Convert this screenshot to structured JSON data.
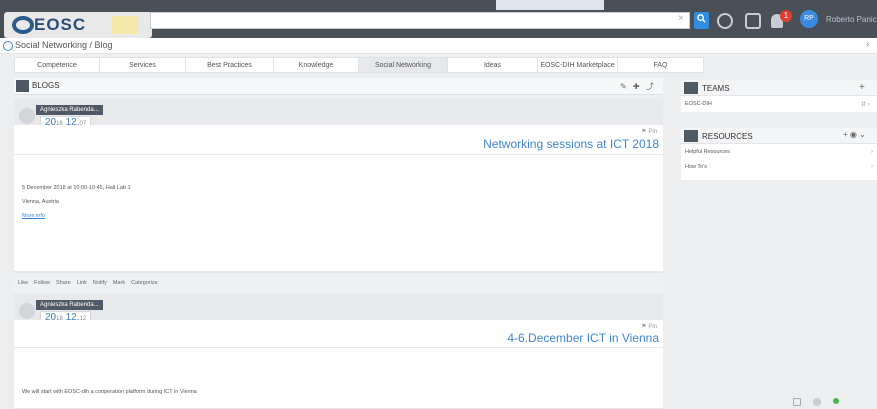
{
  "header": {
    "logo_text": "EOSC",
    "search_placeholder": "",
    "search_clear": "×",
    "search_button_icon": "search-icon",
    "notification_count": "1",
    "avatar_initials": "RP",
    "user_name": "Roberto Panichi"
  },
  "breadcrumb": {
    "text": "Social Networking / Blog",
    "arrow": "›"
  },
  "nav": {
    "tabs": [
      {
        "label": "Competence"
      },
      {
        "label": "Services"
      },
      {
        "label": "Best Practices"
      },
      {
        "label": "Knowledge"
      },
      {
        "label": "Social Networking"
      },
      {
        "label": "Ideas"
      },
      {
        "label": "EOSC-DIH Marketplace"
      },
      {
        "label": "FAQ"
      }
    ]
  },
  "blogs": {
    "title": "BLOGS",
    "tools": "✎ ✚ ⤴"
  },
  "posts": [
    {
      "author": "Agnieszka Rabenda...",
      "year": "20",
      "year_small": "18",
      "day": "12.",
      "day_small": "07",
      "pin": "⚑ Pin",
      "title": "Networking sessions at ICT 2018",
      "line1": "5 December 2018 at 10:00-10:45, Hall Lab 1",
      "line2": "Vienna, Austria",
      "link": "More info"
    },
    {
      "author": "Agnieszka Rabenda...",
      "year": "20",
      "year_small": "18",
      "day": "12.",
      "day_small": "12",
      "pin": "⚑ Pin",
      "title": "4-6.December ICT in Vienna",
      "line1": "We will start with EOSC-dih a cooperation platform during ICT in Vienna"
    }
  ],
  "actions": [
    {
      "label": "Like"
    },
    {
      "label": "Follow"
    },
    {
      "label": "Share"
    },
    {
      "label": "Link"
    },
    {
      "label": "Notify"
    },
    {
      "label": "Mark"
    },
    {
      "label": "Categorize"
    }
  ],
  "sidebar": {
    "teams": {
      "title": "TEAMS",
      "plus": "+",
      "items": [
        {
          "label": "EOSC-DIH",
          "right": "⇵ ›"
        }
      ]
    },
    "resources": {
      "title": "RESOURCES",
      "tools": "+ ◉ ⌄",
      "items": [
        {
          "label": "Helpful Resources",
          "right": "›"
        },
        {
          "label": "How To's",
          "right": "›"
        }
      ]
    }
  },
  "colors": {
    "accent": "#3e85d2",
    "topbar": "#4a5058",
    "alert": "#e03c31"
  }
}
